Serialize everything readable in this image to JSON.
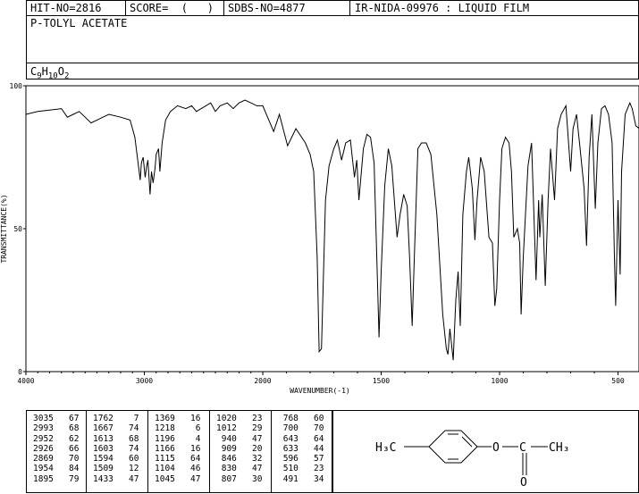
{
  "header": {
    "hit_no": "HIT-NO=2816",
    "score": "SCORE=  (   )",
    "sdbs_no": "SDBS-NO=4877",
    "source": "IR-NIDA-09976 : LIQUID FILM",
    "compound_name": "P-TOLYL ACETATE",
    "formula_main_c": "C",
    "formula_sub_c": "9",
    "formula_main_h": "H",
    "formula_sub_h": "10",
    "formula_main_o": "O",
    "formula_sub_o": "2"
  },
  "chart_data": {
    "type": "line",
    "xlabel": "WAVENUMBER(-1)",
    "ylabel": "TRANSMITTANCE(%)",
    "xlim": [
      4000,
      400
    ],
    "ylim": [
      0,
      100
    ],
    "x_ticks": [
      4000,
      3000,
      2000,
      1500,
      1000,
      500
    ],
    "y_ticks": [
      0,
      50,
      100
    ],
    "x_tick_labels": [
      "4000",
      "3000",
      "2000",
      "1500",
      "1000",
      "500"
    ],
    "y_tick_labels": [
      "0",
      "50",
      "100"
    ],
    "spectrum": [
      [
        4000,
        90
      ],
      [
        3900,
        91
      ],
      [
        3800,
        91.5
      ],
      [
        3700,
        92
      ],
      [
        3650,
        89
      ],
      [
        3600,
        90
      ],
      [
        3550,
        91
      ],
      [
        3500,
        89
      ],
      [
        3450,
        87
      ],
      [
        3400,
        88
      ],
      [
        3350,
        89
      ],
      [
        3300,
        90
      ],
      [
        3200,
        89
      ],
      [
        3120,
        88
      ],
      [
        3080,
        82
      ],
      [
        3050,
        72
      ],
      [
        3035,
        67
      ],
      [
        3025,
        73
      ],
      [
        3010,
        75
      ],
      [
        2993,
        68
      ],
      [
        2980,
        72
      ],
      [
        2970,
        74
      ],
      [
        2952,
        62
      ],
      [
        2940,
        70
      ],
      [
        2926,
        66
      ],
      [
        2910,
        71
      ],
      [
        2900,
        76
      ],
      [
        2880,
        78
      ],
      [
        2869,
        70
      ],
      [
        2850,
        80
      ],
      [
        2820,
        88
      ],
      [
        2780,
        91
      ],
      [
        2720,
        93
      ],
      [
        2650,
        92
      ],
      [
        2600,
        93
      ],
      [
        2560,
        91
      ],
      [
        2520,
        92
      ],
      [
        2480,
        93
      ],
      [
        2440,
        94
      ],
      [
        2400,
        91
      ],
      [
        2360,
        93
      ],
      [
        2300,
        94
      ],
      [
        2250,
        92
      ],
      [
        2200,
        94
      ],
      [
        2150,
        95
      ],
      [
        2100,
        94
      ],
      [
        2050,
        93
      ],
      [
        2000,
        93
      ],
      [
        1954,
        84
      ],
      [
        1930,
        90
      ],
      [
        1895,
        79
      ],
      [
        1860,
        85
      ],
      [
        1820,
        80
      ],
      [
        1800,
        76
      ],
      [
        1785,
        70
      ],
      [
        1770,
        40
      ],
      [
        1762,
        7
      ],
      [
        1752,
        8
      ],
      [
        1745,
        30
      ],
      [
        1735,
        60
      ],
      [
        1720,
        72
      ],
      [
        1700,
        78
      ],
      [
        1685,
        81
      ],
      [
        1667,
        74
      ],
      [
        1650,
        80
      ],
      [
        1630,
        81
      ],
      [
        1613,
        68
      ],
      [
        1603,
        74
      ],
      [
        1594,
        60
      ],
      [
        1575,
        78
      ],
      [
        1560,
        83
      ],
      [
        1545,
        82
      ],
      [
        1530,
        73
      ],
      [
        1515,
        30
      ],
      [
        1509,
        12
      ],
      [
        1500,
        35
      ],
      [
        1485,
        65
      ],
      [
        1470,
        78
      ],
      [
        1455,
        72
      ],
      [
        1433,
        47
      ],
      [
        1420,
        55
      ],
      [
        1405,
        62
      ],
      [
        1390,
        58
      ],
      [
        1380,
        40
      ],
      [
        1369,
        16
      ],
      [
        1360,
        40
      ],
      [
        1345,
        78
      ],
      [
        1330,
        80
      ],
      [
        1310,
        80
      ],
      [
        1290,
        76
      ],
      [
        1265,
        55
      ],
      [
        1240,
        20
      ],
      [
        1225,
        8
      ],
      [
        1218,
        6
      ],
      [
        1210,
        15
      ],
      [
        1196,
        4
      ],
      [
        1185,
        25
      ],
      [
        1175,
        35
      ],
      [
        1166,
        16
      ],
      [
        1155,
        55
      ],
      [
        1140,
        70
      ],
      [
        1130,
        75
      ],
      [
        1115,
        64
      ],
      [
        1104,
        46
      ],
      [
        1095,
        60
      ],
      [
        1080,
        75
      ],
      [
        1065,
        70
      ],
      [
        1045,
        47
      ],
      [
        1030,
        45
      ],
      [
        1020,
        23
      ],
      [
        1012,
        29
      ],
      [
        1000,
        60
      ],
      [
        990,
        78
      ],
      [
        975,
        82
      ],
      [
        960,
        80
      ],
      [
        950,
        70
      ],
      [
        940,
        47
      ],
      [
        925,
        50
      ],
      [
        915,
        45
      ],
      [
        909,
        20
      ],
      [
        900,
        40
      ],
      [
        880,
        72
      ],
      [
        865,
        80
      ],
      [
        846,
        32
      ],
      [
        835,
        60
      ],
      [
        830,
        47
      ],
      [
        820,
        62
      ],
      [
        807,
        30
      ],
      [
        795,
        60
      ],
      [
        785,
        78
      ],
      [
        768,
        60
      ],
      [
        755,
        85
      ],
      [
        740,
        90
      ],
      [
        720,
        93
      ],
      [
        700,
        70
      ],
      [
        690,
        85
      ],
      [
        675,
        90
      ],
      [
        660,
        78
      ],
      [
        643,
        64
      ],
      [
        633,
        44
      ],
      [
        622,
        75
      ],
      [
        610,
        90
      ],
      [
        596,
        57
      ],
      [
        585,
        80
      ],
      [
        570,
        92
      ],
      [
        555,
        93
      ],
      [
        540,
        90
      ],
      [
        525,
        80
      ],
      [
        515,
        40
      ],
      [
        510,
        23
      ],
      [
        500,
        60
      ],
      [
        491,
        34
      ],
      [
        485,
        70
      ],
      [
        470,
        90
      ],
      [
        450,
        94
      ],
      [
        440,
        92
      ],
      [
        425,
        86
      ],
      [
        410,
        85
      ],
      [
        400,
        88
      ]
    ],
    "peak_table": [
      [
        3035,
        67
      ],
      [
        2993,
        68
      ],
      [
        2952,
        62
      ],
      [
        2926,
        66
      ],
      [
        2869,
        70
      ],
      [
        1954,
        84
      ],
      [
        1895,
        79
      ],
      [
        1762,
        7
      ],
      [
        1667,
        74
      ],
      [
        1613,
        68
      ],
      [
        1603,
        74
      ],
      [
        1594,
        60
      ],
      [
        1509,
        12
      ],
      [
        1433,
        47
      ],
      [
        1369,
        16
      ],
      [
        1218,
        6
      ],
      [
        1196,
        4
      ],
      [
        1166,
        16
      ],
      [
        1115,
        64
      ],
      [
        1104,
        46
      ],
      [
        1045,
        47
      ],
      [
        1020,
        23
      ],
      [
        1012,
        29
      ],
      [
        940,
        47
      ],
      [
        909,
        20
      ],
      [
        846,
        32
      ],
      [
        830,
        47
      ],
      [
        807,
        30
      ],
      [
        768,
        60
      ],
      [
        700,
        70
      ],
      [
        643,
        64
      ],
      [
        633,
        44
      ],
      [
        596,
        57
      ],
      [
        510,
        23
      ],
      [
        491,
        34
      ]
    ]
  },
  "structure": {
    "left_group": "H₃C",
    "ester_o": "O",
    "carbonyl_c": "C",
    "methyl": "CH₃",
    "carbonyl_o": "O"
  }
}
